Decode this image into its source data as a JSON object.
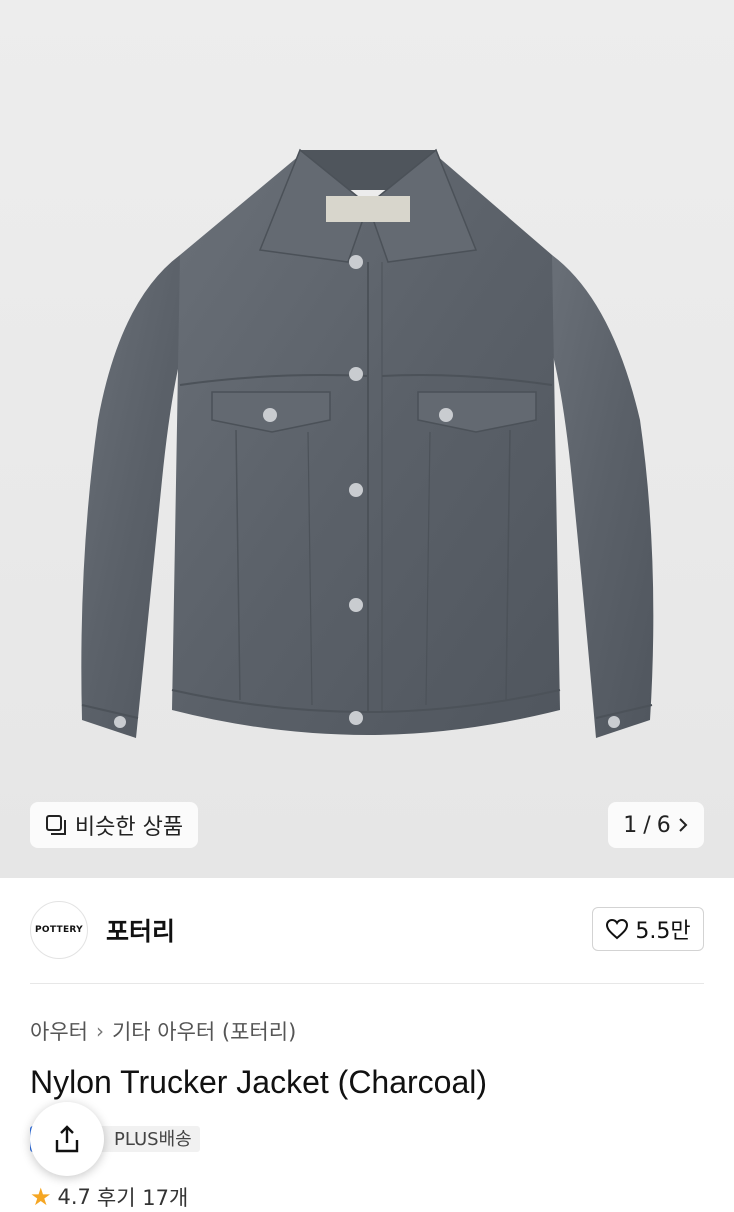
{
  "gallery": {
    "similar_label": "비슷한 상품",
    "current": "1",
    "total": "6",
    "counter_sep": "/"
  },
  "brand": {
    "logo_text": "POTTERY",
    "name": "포터리",
    "likes": "5.5만"
  },
  "product": {
    "breadcrumb": [
      "아우터",
      "기타 아우터 (포터리)"
    ],
    "title": "Nylon Trucker Jacket (Charcoal)",
    "badge": "PLUS배송",
    "rating": "4.7",
    "reviews": "후기 17개"
  },
  "colors": {
    "jacket": "#5f656d",
    "accent_blue": "#2f6fe0",
    "star": "#f5a623"
  },
  "icons": {
    "similar": "similar-items-icon",
    "next": "chevron-right-icon",
    "like": "heart-icon",
    "share": "share-icon",
    "star": "star-icon"
  }
}
